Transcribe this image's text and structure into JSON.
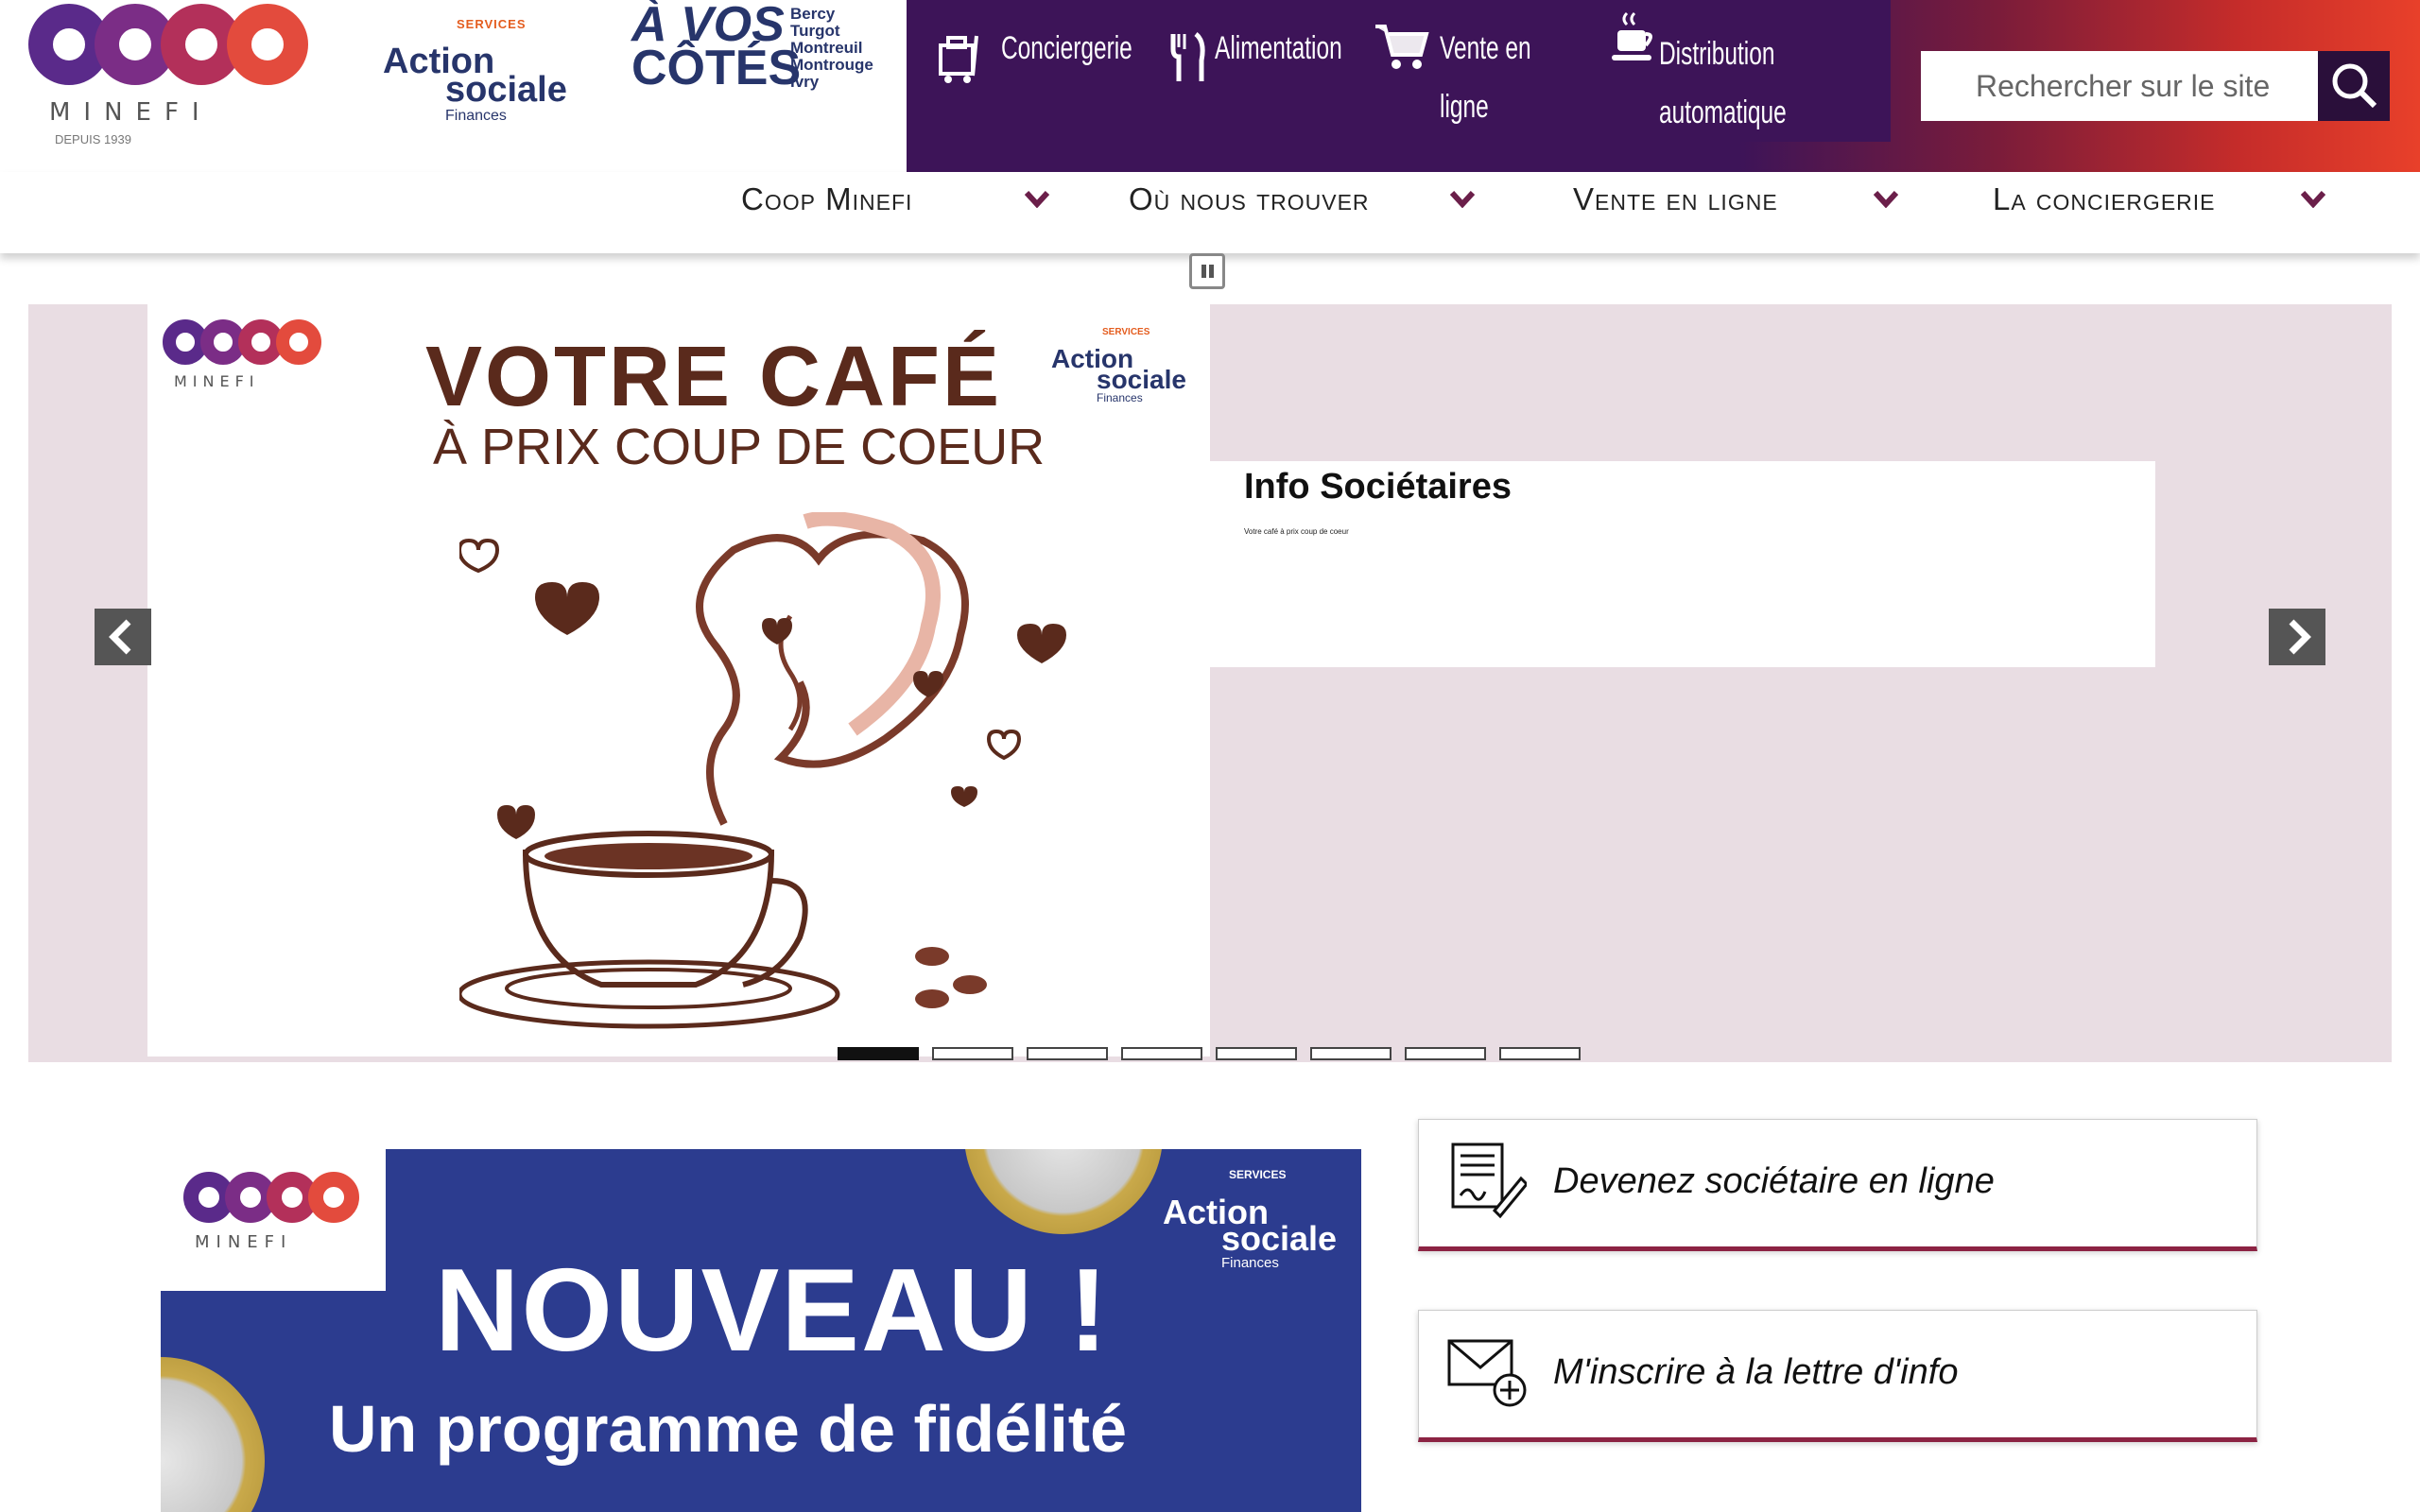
{
  "header": {
    "coop_logo": {
      "letters": "coop",
      "name": "MINEFI",
      "since": "DEPUIS 1939"
    },
    "action_sociale_logo": {
      "services": "SERVICES",
      "line1": "Action",
      "line2": "sociale",
      "line3": "Finances"
    },
    "a_vos_cotes_logo": {
      "line1": "À VOS",
      "line2": "CÔTÉS",
      "towns": [
        "Bercy",
        "Turgot",
        "Montreuil",
        "Montrouge",
        "Ivry"
      ]
    },
    "services": [
      {
        "label": "Conciergerie",
        "icon": "concierge-bag-icon"
      },
      {
        "label": "Alimentation",
        "icon": "fork-knife-icon"
      },
      {
        "label": "Vente en ligne",
        "icon": "shopping-cart-icon"
      },
      {
        "label": "Distribution automatique",
        "icon": "hot-drink-cup-icon"
      }
    ],
    "search": {
      "placeholder": "Rechercher sur le site",
      "icon": "search-icon"
    }
  },
  "nav": [
    {
      "label": "Coop Minefi"
    },
    {
      "label": "Où nous trouver"
    },
    {
      "label": "Vente en ligne"
    },
    {
      "label": "La conciergerie"
    }
  ],
  "carousel": {
    "slide": {
      "title_line1": "VOTRE CAFÉ",
      "title_line2": "À PRIX COUP DE COEUR",
      "logo_coop_name": "MINEFI",
      "logo_as_services": "SERVICES",
      "logo_as_line1": "Action",
      "logo_as_line2": "sociale",
      "logo_as_line3": "Finances"
    },
    "caption_title": "Info Sociétaires",
    "caption_text": "Votre café à prix coup de coeur",
    "slide_count": 8,
    "active_index": 0
  },
  "promo": {
    "coop_name": "MINEFI",
    "headline": "NOUVEAU !",
    "subline": "Un programme de fidélité",
    "as_services": "SERVICES",
    "as_line1": "Action",
    "as_line2": "sociale",
    "as_line3": "Finances"
  },
  "cards": [
    {
      "label": "Devenez sociétaire en ligne",
      "icon": "signed-document-icon"
    },
    {
      "label": "M'inscrire à la lettre d'info",
      "icon": "envelope-plus-icon"
    }
  ],
  "colors": {
    "brand_purple": "#3d1458",
    "brand_red": "#e8402a",
    "card_accent": "#8c2343",
    "slider_bg": "#e9dde3",
    "coffee_brown": "#5a2a1c",
    "promo_blue": "#2c3c8f"
  }
}
